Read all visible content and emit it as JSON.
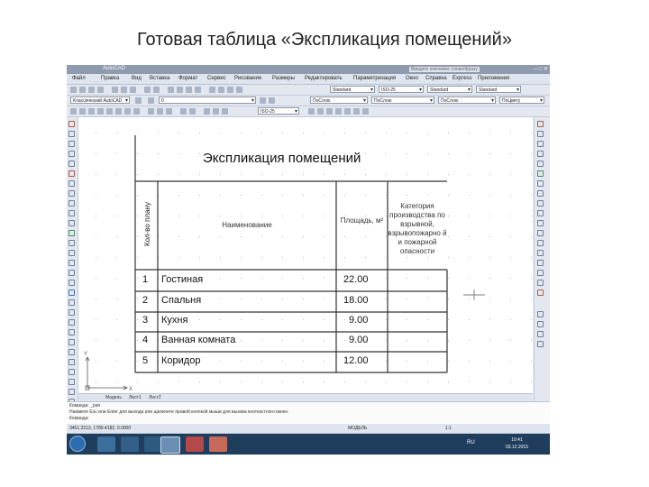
{
  "slide": {
    "title": "Готовая таблица «Экспликация помещений»"
  },
  "app": {
    "window_title": "AutoCAD",
    "search_placeholder": "Введите ключевое слово/фразу",
    "menu": [
      "Файл",
      "Правка",
      "Вид",
      "Вставка",
      "Формат",
      "Сервис",
      "Рисование",
      "Размеры",
      "Редактировать",
      "Параметризация",
      "Окно",
      "Справка",
      "Express",
      "Приложения"
    ],
    "combos": {
      "workspace": "Классический AutoCAD",
      "text_style": "Standard",
      "dim_style": "ISO-25",
      "layer": "0",
      "color": "ПоСлою",
      "linetype": "ПоСлою",
      "lineweight": "ПоСлою",
      "plot_style": "ПоЦвету",
      "table_style": "Standard",
      "multileader_style": "Standard"
    },
    "layout_tabs": [
      "Модель",
      "Лист1",
      "Лист2"
    ],
    "command_lines": [
      "Команда: _pan",
      "Нажмите Esc или Enter для выхода или щелкните правой кнопкой мыши для вызова контекстного меню.",
      "Команда:"
    ],
    "status": {
      "coords": "3451.2213, 1789.4182, 0.0000",
      "model_label": "МОДЕЛЬ",
      "annotation_scale": "1:1"
    },
    "taskbar": {
      "language": "RU",
      "time": "10:41",
      "date": "03.12.2015"
    }
  },
  "table": {
    "title": "Экспликация помещений",
    "headers": {
      "number": "Кол-во плану",
      "name": "Наименование",
      "area": "Площадь, м²",
      "category": "Категория производства по взрывной, взрывопожарно й и пожарной опасности"
    },
    "rows": [
      {
        "num": "1",
        "name": "Гостиная",
        "area": "22.00"
      },
      {
        "num": "2",
        "name": "Спальня",
        "area": "18.00"
      },
      {
        "num": "3",
        "name": "Кухня",
        "area": "9.00"
      },
      {
        "num": "4",
        "name": "Ванная комната",
        "area": "9.00"
      },
      {
        "num": "5",
        "name": "Коридор",
        "area": "12.00"
      }
    ]
  },
  "icons": [
    "start-orb-icon",
    "explorer-icon",
    "media-player-icon",
    "ie-icon",
    "autocad-icon",
    "folder-icon",
    "ucs-icon"
  ],
  "colors": {
    "taskbar": "#1f3d5d",
    "titlebar": "#8e9aad",
    "table_lines": "#333333"
  }
}
